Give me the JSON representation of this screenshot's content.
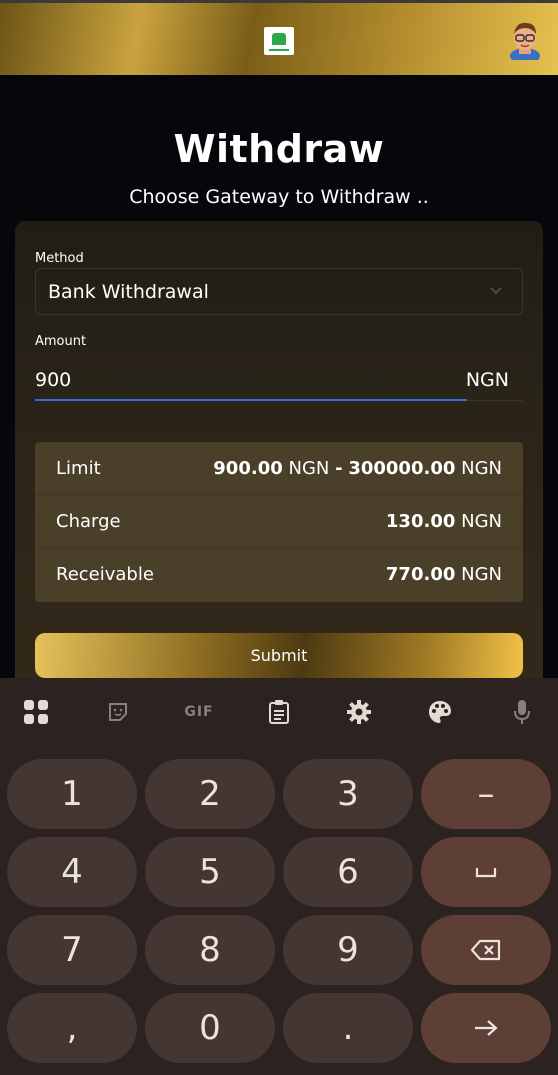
{
  "header": {
    "logo_icon": "house-logo-icon",
    "avatar_icon": "user-avatar-icon"
  },
  "page": {
    "title": "Withdraw",
    "subtitle": "Choose Gateway to Withdraw .."
  },
  "form": {
    "method_label": "Method",
    "method_value": "Bank Withdrawal",
    "amount_label": "Amount",
    "amount_value": "900",
    "amount_unit": "NGN",
    "submit_label": "Submit"
  },
  "info": {
    "limit_label": "Limit",
    "limit_min": "900.00",
    "limit_min_unit": "NGN",
    "limit_sep": "-",
    "limit_max": "300000.00",
    "limit_max_unit": "NGN",
    "charge_label": "Charge",
    "charge_value": "130.00",
    "charge_unit": "NGN",
    "receivable_label": "Receivable",
    "receivable_value": "770.00",
    "receivable_unit": "NGN"
  },
  "keyboard": {
    "toolbar_icons": [
      "apps-grid-icon",
      "sticker-icon",
      "gif-icon",
      "clipboard-icon",
      "settings-icon",
      "palette-icon",
      "microphone-icon"
    ],
    "gif_label": "GIF",
    "keys": {
      "k1": "1",
      "k2": "2",
      "k3": "3",
      "minus": "–",
      "k4": "4",
      "k5": "5",
      "k6": "6",
      "k7": "7",
      "k8": "8",
      "k9": "9",
      "comma": ",",
      "k0": "0",
      "period": "."
    },
    "space_icon": "space-bar-icon",
    "backspace_icon": "backspace-icon",
    "enter_icon": "arrow-right-icon"
  }
}
